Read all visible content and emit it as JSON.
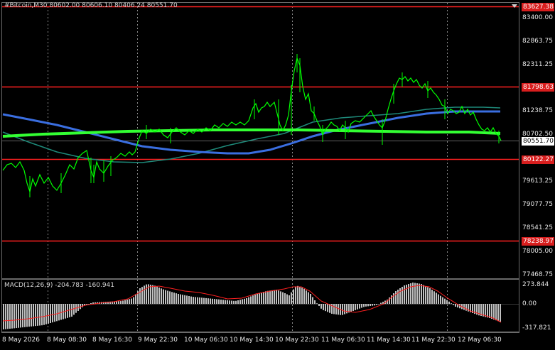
{
  "header": {
    "title": "#Bitcoin,M30  80602.00 80606.10 80406.24 80551.70"
  },
  "price_axis": {
    "ticks": [
      "83400.00",
      "82863.75",
      "82311.25",
      "81238.75",
      "80702.50",
      "79613.25",
      "79077.75",
      "78541.25",
      "78005.00",
      "77468.75"
    ]
  },
  "levels": [
    {
      "label": "83627.38",
      "kind": "resistance"
    },
    {
      "label": "81798.63",
      "kind": "resistance"
    },
    {
      "label": "80122.27",
      "kind": "support"
    },
    {
      "label": "78238.97",
      "kind": "support"
    }
  ],
  "current_price": "80551.70",
  "time_axis": {
    "labels": [
      "8 May 2026",
      "8 May 08:30",
      "8 May 16:30",
      "9 May 22:30",
      "10 May 06:30",
      "10 May 14:30",
      "10 May 22:30",
      "11 May 06:30",
      "11 May 14:30",
      "11 May 22:30",
      "12 May 06:30"
    ]
  },
  "macd": {
    "label": "MACD(12,26,9) -204.783 -160.941",
    "ticks": [
      "273.844",
      "0.00",
      "-317.821"
    ]
  },
  "colors": {
    "background": "#000000",
    "candles": "#00ff00",
    "level_lines": "#ff2020",
    "ma_fast": "#3a6ee0",
    "ma_slow": "#1e8a7a",
    "ma_long": "#33ff33",
    "macd_histogram": "#c0c0c0",
    "macd_signal": "#ff2020"
  }
}
